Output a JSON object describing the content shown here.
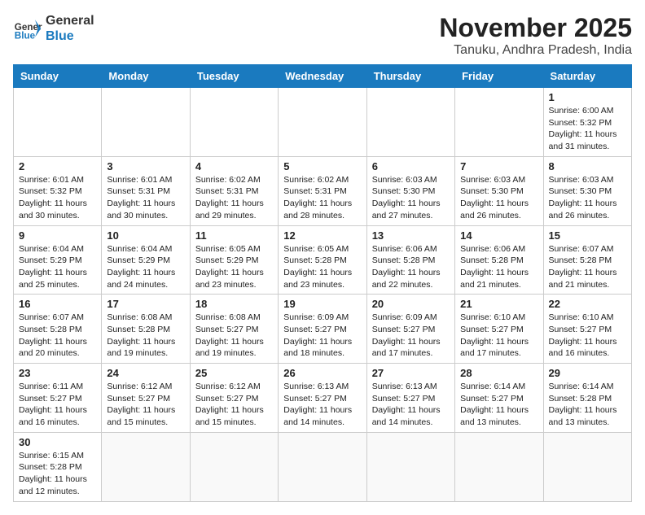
{
  "header": {
    "logo_general": "General",
    "logo_blue": "Blue",
    "month_title": "November 2025",
    "location": "Tanuku, Andhra Pradesh, India"
  },
  "days_of_week": [
    "Sunday",
    "Monday",
    "Tuesday",
    "Wednesday",
    "Thursday",
    "Friday",
    "Saturday"
  ],
  "weeks": [
    [
      {
        "day": "",
        "info": ""
      },
      {
        "day": "",
        "info": ""
      },
      {
        "day": "",
        "info": ""
      },
      {
        "day": "",
        "info": ""
      },
      {
        "day": "",
        "info": ""
      },
      {
        "day": "",
        "info": ""
      },
      {
        "day": "1",
        "info": "Sunrise: 6:00 AM\nSunset: 5:32 PM\nDaylight: 11 hours and 31 minutes."
      }
    ],
    [
      {
        "day": "2",
        "info": "Sunrise: 6:01 AM\nSunset: 5:32 PM\nDaylight: 11 hours and 30 minutes."
      },
      {
        "day": "3",
        "info": "Sunrise: 6:01 AM\nSunset: 5:31 PM\nDaylight: 11 hours and 30 minutes."
      },
      {
        "day": "4",
        "info": "Sunrise: 6:02 AM\nSunset: 5:31 PM\nDaylight: 11 hours and 29 minutes."
      },
      {
        "day": "5",
        "info": "Sunrise: 6:02 AM\nSunset: 5:31 PM\nDaylight: 11 hours and 28 minutes."
      },
      {
        "day": "6",
        "info": "Sunrise: 6:03 AM\nSunset: 5:30 PM\nDaylight: 11 hours and 27 minutes."
      },
      {
        "day": "7",
        "info": "Sunrise: 6:03 AM\nSunset: 5:30 PM\nDaylight: 11 hours and 26 minutes."
      },
      {
        "day": "8",
        "info": "Sunrise: 6:03 AM\nSunset: 5:30 PM\nDaylight: 11 hours and 26 minutes."
      }
    ],
    [
      {
        "day": "9",
        "info": "Sunrise: 6:04 AM\nSunset: 5:29 PM\nDaylight: 11 hours and 25 minutes."
      },
      {
        "day": "10",
        "info": "Sunrise: 6:04 AM\nSunset: 5:29 PM\nDaylight: 11 hours and 24 minutes."
      },
      {
        "day": "11",
        "info": "Sunrise: 6:05 AM\nSunset: 5:29 PM\nDaylight: 11 hours and 23 minutes."
      },
      {
        "day": "12",
        "info": "Sunrise: 6:05 AM\nSunset: 5:28 PM\nDaylight: 11 hours and 23 minutes."
      },
      {
        "day": "13",
        "info": "Sunrise: 6:06 AM\nSunset: 5:28 PM\nDaylight: 11 hours and 22 minutes."
      },
      {
        "day": "14",
        "info": "Sunrise: 6:06 AM\nSunset: 5:28 PM\nDaylight: 11 hours and 21 minutes."
      },
      {
        "day": "15",
        "info": "Sunrise: 6:07 AM\nSunset: 5:28 PM\nDaylight: 11 hours and 21 minutes."
      }
    ],
    [
      {
        "day": "16",
        "info": "Sunrise: 6:07 AM\nSunset: 5:28 PM\nDaylight: 11 hours and 20 minutes."
      },
      {
        "day": "17",
        "info": "Sunrise: 6:08 AM\nSunset: 5:28 PM\nDaylight: 11 hours and 19 minutes."
      },
      {
        "day": "18",
        "info": "Sunrise: 6:08 AM\nSunset: 5:27 PM\nDaylight: 11 hours and 19 minutes."
      },
      {
        "day": "19",
        "info": "Sunrise: 6:09 AM\nSunset: 5:27 PM\nDaylight: 11 hours and 18 minutes."
      },
      {
        "day": "20",
        "info": "Sunrise: 6:09 AM\nSunset: 5:27 PM\nDaylight: 11 hours and 17 minutes."
      },
      {
        "day": "21",
        "info": "Sunrise: 6:10 AM\nSunset: 5:27 PM\nDaylight: 11 hours and 17 minutes."
      },
      {
        "day": "22",
        "info": "Sunrise: 6:10 AM\nSunset: 5:27 PM\nDaylight: 11 hours and 16 minutes."
      }
    ],
    [
      {
        "day": "23",
        "info": "Sunrise: 6:11 AM\nSunset: 5:27 PM\nDaylight: 11 hours and 16 minutes."
      },
      {
        "day": "24",
        "info": "Sunrise: 6:12 AM\nSunset: 5:27 PM\nDaylight: 11 hours and 15 minutes."
      },
      {
        "day": "25",
        "info": "Sunrise: 6:12 AM\nSunset: 5:27 PM\nDaylight: 11 hours and 15 minutes."
      },
      {
        "day": "26",
        "info": "Sunrise: 6:13 AM\nSunset: 5:27 PM\nDaylight: 11 hours and 14 minutes."
      },
      {
        "day": "27",
        "info": "Sunrise: 6:13 AM\nSunset: 5:27 PM\nDaylight: 11 hours and 14 minutes."
      },
      {
        "day": "28",
        "info": "Sunrise: 6:14 AM\nSunset: 5:27 PM\nDaylight: 11 hours and 13 minutes."
      },
      {
        "day": "29",
        "info": "Sunrise: 6:14 AM\nSunset: 5:28 PM\nDaylight: 11 hours and 13 minutes."
      }
    ],
    [
      {
        "day": "30",
        "info": "Sunrise: 6:15 AM\nSunset: 5:28 PM\nDaylight: 11 hours and 12 minutes."
      },
      {
        "day": "",
        "info": ""
      },
      {
        "day": "",
        "info": ""
      },
      {
        "day": "",
        "info": ""
      },
      {
        "day": "",
        "info": ""
      },
      {
        "day": "",
        "info": ""
      },
      {
        "day": "",
        "info": ""
      }
    ]
  ]
}
